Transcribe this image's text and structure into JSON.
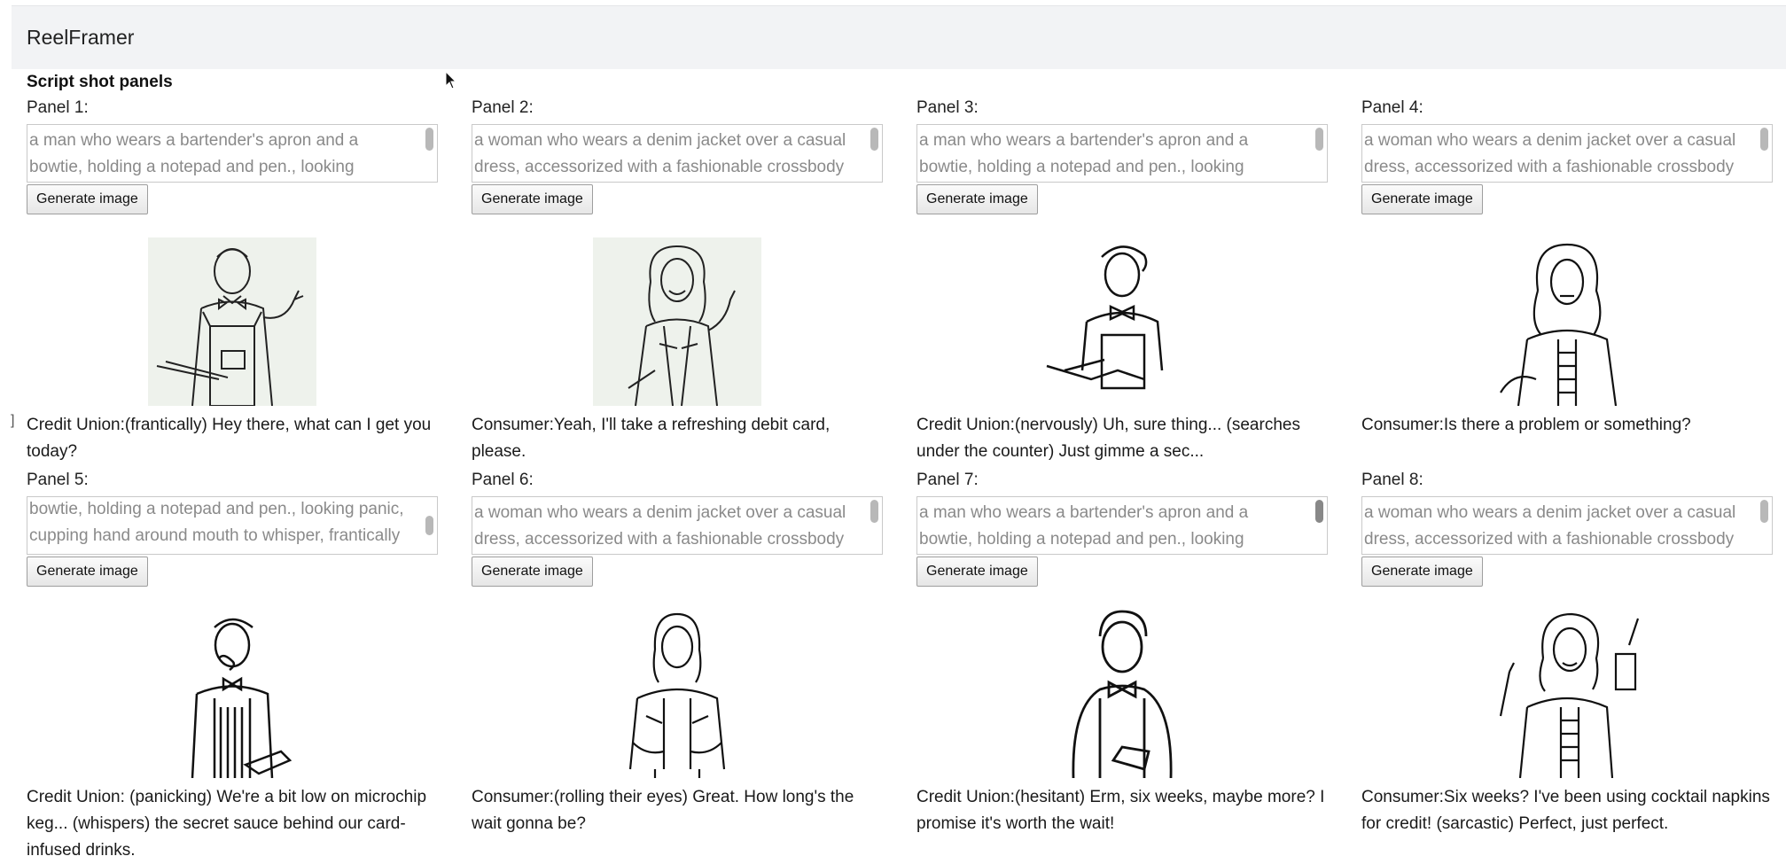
{
  "app": {
    "title": "ReelFramer"
  },
  "section": {
    "title": "Script shot panels"
  },
  "button_label": "Generate image",
  "panels": [
    {
      "label": "Panel 1:",
      "prompt": "a man who wears a bartender's apron and a bowtie, holding a notepad and pen., looking",
      "caption": "Credit Union:(frantically) Hey there, what can I get you today?",
      "image": "bartender-man-sketch"
    },
    {
      "label": "Panel 2:",
      "prompt": "a woman who wears a denim jacket over a casual dress, accessorized with a fashionable crossbody",
      "caption": "Consumer:Yeah, I'll take a refreshing debit card, please.",
      "image": "denim-woman-sketch"
    },
    {
      "label": "Panel 3:",
      "prompt": "a man who wears a bartender's apron and a bowtie, holding a notepad and pen., looking",
      "caption": "Credit Union:(nervously) Uh, sure thing... (searches under the counter) Just gimme a sec...",
      "image": "bartender-man-sketch"
    },
    {
      "label": "Panel 4:",
      "prompt": "a woman who wears a denim jacket over a casual dress, accessorized with a fashionable crossbody",
      "caption": "Consumer:Is there a problem or something?",
      "image": "denim-woman-sketch"
    },
    {
      "label": "Panel 5:",
      "prompt": "bowtie, holding a notepad and pen., looking panic, cupping hand around mouth to whisper, frantically looking around. Lo",
      "caption": "Credit Union:  (panicking) We're a bit low on microchip keg... (whispers) the secret sauce behind our card-infused drinks.",
      "image": "bartender-man-sketch"
    },
    {
      "label": "Panel 6:",
      "prompt": "a woman who wears a denim jacket over a casual dress, accessorized with a fashionable crossbody",
      "caption": "Consumer:(rolling their eyes) Great. How long's the wait gonna be?",
      "image": "denim-woman-sketch"
    },
    {
      "label": "Panel 7:",
      "prompt": "a man who wears a bartender's apron and a bowtie, holding a notepad and pen., looking",
      "caption": "Credit Union:(hesitant) Erm, six weeks, maybe more? I promise it's worth the wait!",
      "image": "bartender-man-sketch"
    },
    {
      "label": "Panel 8:",
      "prompt": "a woman who wears a denim jacket over a casual dress, accessorized with a fashionable crossbody",
      "caption": "Consumer:Six weeks? I've been using cocktail napkins for credit! (sarcastic) Perfect, just perfect.",
      "image": "denim-woman-sketch"
    }
  ]
}
